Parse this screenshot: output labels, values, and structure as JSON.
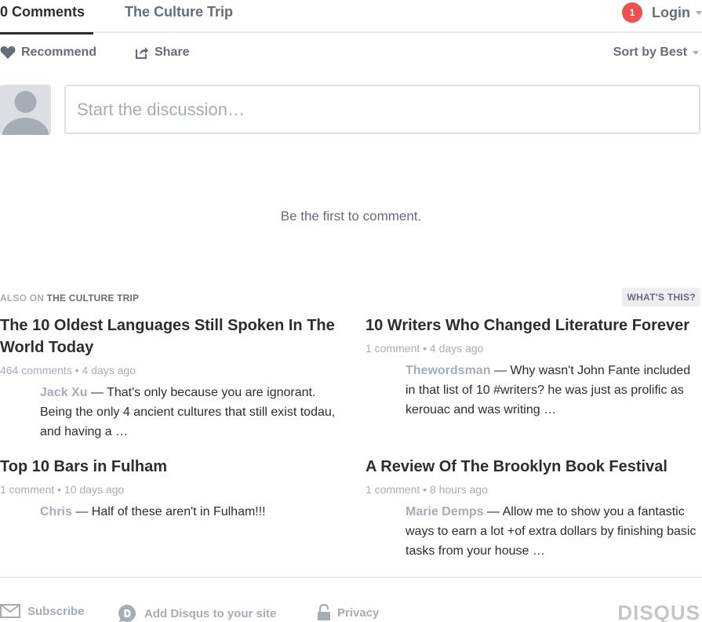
{
  "nav": {
    "comments_tab": "0 Comments",
    "site_tab": "The Culture Trip",
    "notification_count": "1",
    "login_label": "Login"
  },
  "toolbar": {
    "recommend_label": "Recommend",
    "share_label": "Share",
    "sort_label": "Sort by Best"
  },
  "composer": {
    "placeholder": "Start the discussion…"
  },
  "empty_message": "Be the first to comment.",
  "also_on": {
    "prefix": "ALSO ON",
    "site": "THE CULTURE TRIP",
    "whats_this": "WHAT'S THIS?",
    "items": [
      {
        "title": "The 10 Oldest Languages Still Spoken In The World Today",
        "meta": "464 comments • 4 days ago",
        "author": "Jack Xu",
        "excerpt": " — That's only because you are ignorant. Being the only 4 ancient cultures that still exist todau, and having a …"
      },
      {
        "title": "10 Writers Who Changed Literature Forever",
        "meta": "1 comment • 4 days ago",
        "author": "Thewordsman",
        "excerpt": " — Why wasn't John Fante included in that list of 10 #writers? he was just as prolific as kerouac and was writing …"
      },
      {
        "title": "Top 10 Bars in Fulham",
        "meta": "1 comment • 10 days ago",
        "author": "Chris",
        "excerpt": " — Half of these aren't in Fulham!!!"
      },
      {
        "title": "A Review Of The Brooklyn Book Festival",
        "meta": "1 comment • 8 hours ago",
        "author": "Marie Demps",
        "excerpt": " — Allow me to show you a fantastic ways to earn a lot +of extra dollars by finishing basic tasks from your house …"
      }
    ]
  },
  "footer": {
    "subscribe": "Subscribe",
    "add_disqus": "Add Disqus to your site",
    "privacy": "Privacy",
    "logo": "DISQUS"
  },
  "icons": {
    "recommend": "heart-icon",
    "share": "share-icon",
    "subscribe": "envelope-icon",
    "add_disqus": "disqus-d-icon",
    "privacy": "lock-icon"
  },
  "colors": {
    "notification_badge": "#f04f4f",
    "text_primary": "#2a2e2e",
    "text_muted": "#656c7a",
    "text_light": "#a5adb6"
  }
}
